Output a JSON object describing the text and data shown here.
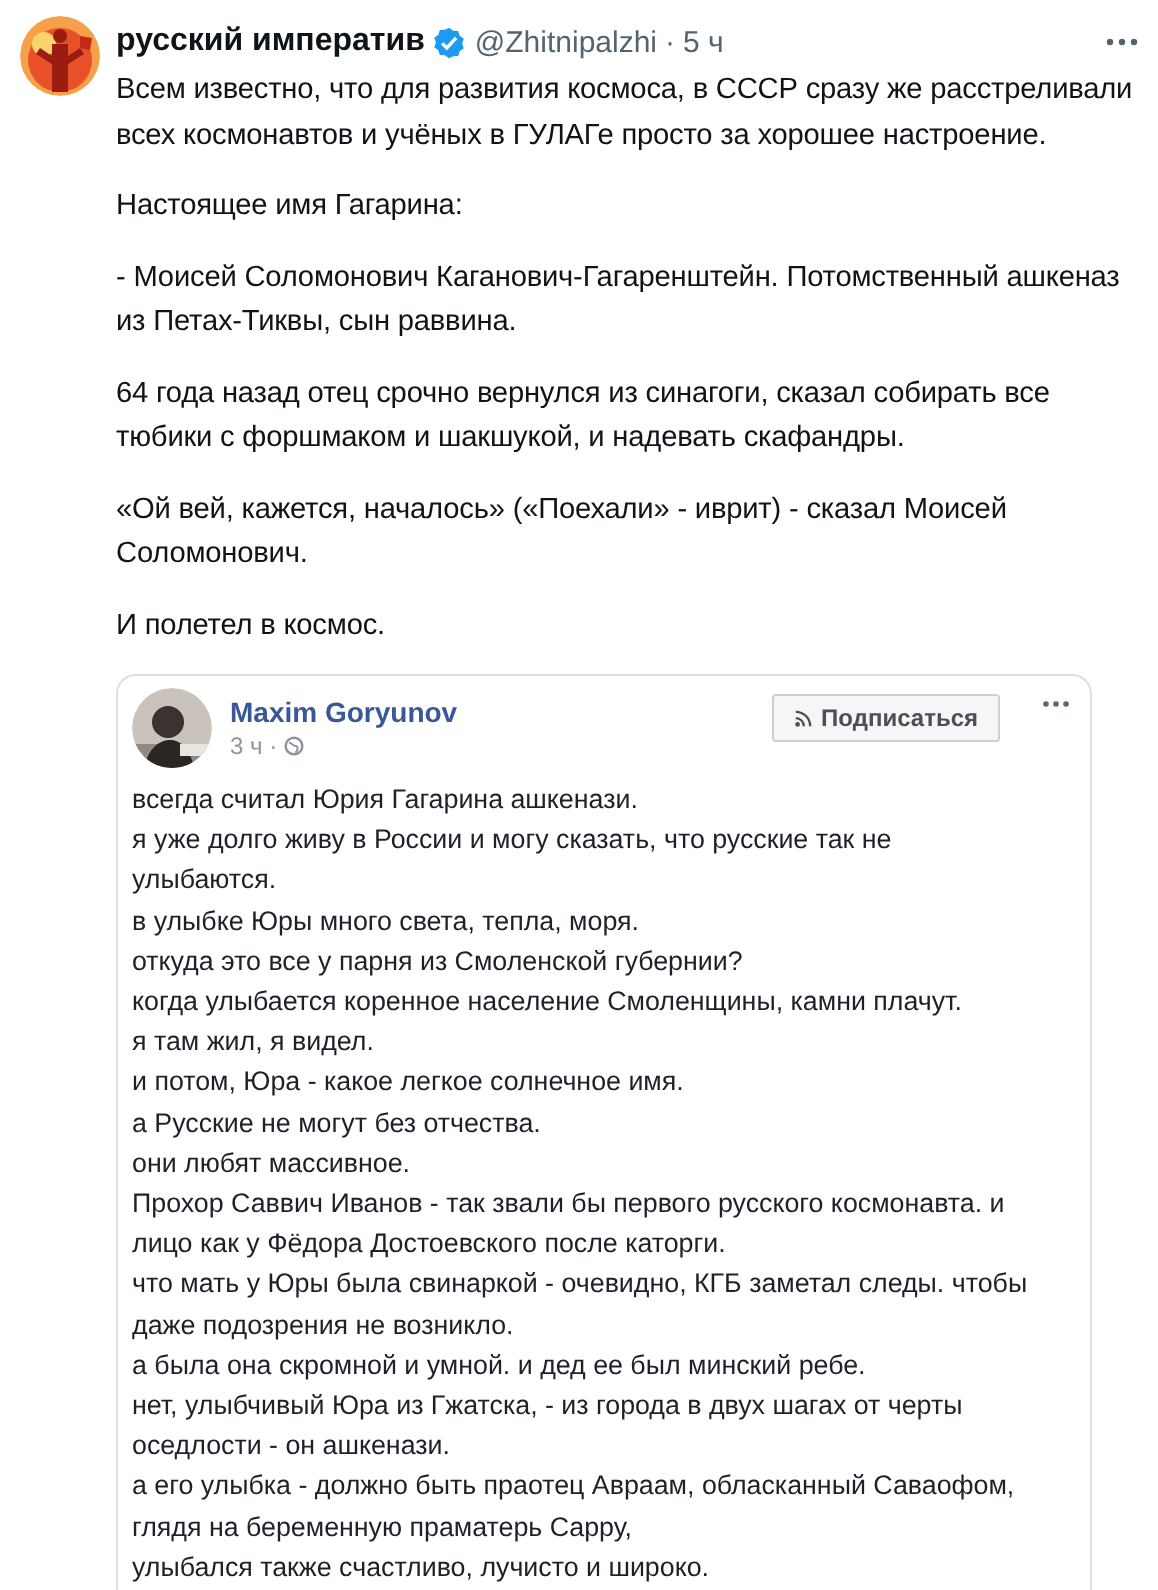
{
  "tweet": {
    "author": "русский императив",
    "verified": true,
    "handle": "@Zhitnipalzhi",
    "separator": "·",
    "time": "5 ч",
    "paragraphs": [
      "Всем известно, что для развития космоса, в СССР сразу же расстреливали всех космонавтов и учёных в ГУЛАГе просто за хорошее настроение.",
      "Настоящее имя Гагарина:",
      "- Моисей Соломонович Каганович-Гагаренштейн. Потомственный ашкеназ из Петах-Тиквы, сын раввина.",
      "64 года назад отец срочно вернулся из синагоги, сказал собирать все тюбики с форшмаком и шакшукой, и надевать скафандры.",
      "«Ой вей, кажется, началось» («Поехали» - иврит) - сказал Моисей Соломонович.",
      "И полетел в космос."
    ]
  },
  "embedded_post": {
    "author": "Maxim Goryunov",
    "time": "3 ч ·",
    "subscribe_button": "Подписаться",
    "lines": [
      [
        "всегда считал Юрия Гагарина ашкенази."
      ],
      [
        "я уже долго живу в России и могу сказать, что русские так не",
        "улыбаются."
      ],
      [
        "в улыбке Юры много света, тепла, моря."
      ],
      [
        "откуда это все у парня из Смоленской губернии?"
      ],
      [
        "когда улыбается коренное население Смоленщины, камни плачут."
      ],
      [
        "я там жил, я видел."
      ],
      [
        "и потом, Юра - какое легкое солнечное имя."
      ],
      [
        "а Русские не могут без отчества."
      ],
      [
        "они любят массивное."
      ],
      [
        "Прохор Саввич Иванов - так звали бы первого русского космонавта. и",
        "лицо как у Фёдора Достоевского после каторги."
      ],
      [
        "что мать у Юры была свинаркой - очевидно, КГБ заметал следы. чтобы",
        "даже подозрения не возникло."
      ],
      [
        "а была она скромной и умной. и дед ее был минский ребе."
      ],
      [
        "нет, улыбчивый Юра из Гжатска, - из города в двух шагах от черты",
        "оседлости - он ашкенази."
      ],
      [
        "а его улыбка - должно быть праотец Авраам, обласканный Саваофом,",
        "глядя на беременную праматерь Сарру,",
        "улыбался также счастливо, лучисто и широко."
      ]
    ]
  }
}
